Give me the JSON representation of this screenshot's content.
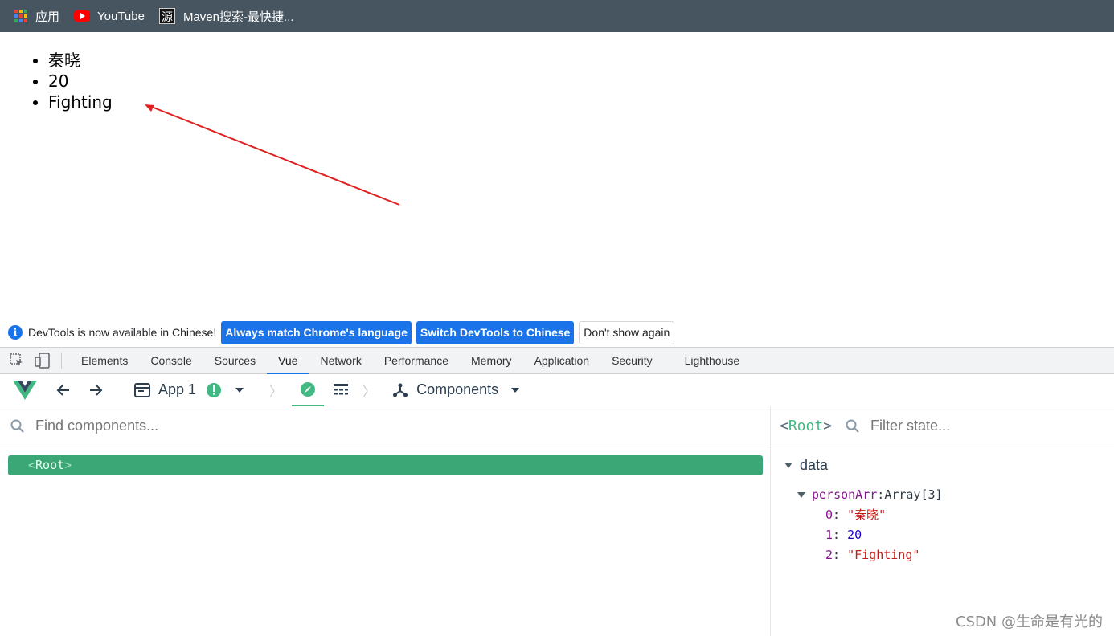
{
  "bookmarks": [
    {
      "label": "应用",
      "icon": "apps-grid-icon"
    },
    {
      "label": "YouTube",
      "icon": "youtube-icon"
    },
    {
      "label": "Maven搜索-最快捷...",
      "icon": "source-icon",
      "icon_text": "源"
    }
  ],
  "page": {
    "list": [
      "秦晓",
      "20",
      "Fighting"
    ]
  },
  "infobar": {
    "message": "DevTools is now available in Chinese!",
    "btn_match": "Always match Chrome's language",
    "btn_switch": "Switch DevTools to Chinese",
    "btn_dismiss": "Don't show again"
  },
  "devtools_tabs": [
    "Elements",
    "Console",
    "Sources",
    "Vue",
    "Network",
    "Performance",
    "Memory",
    "Application",
    "Security",
    "Lighthouse"
  ],
  "active_tab": "Vue",
  "vue_toolbar": {
    "app_label": "App 1",
    "view_label": "Components"
  },
  "components": {
    "search_placeholder": "Find components...",
    "root_name": "Root"
  },
  "inspector": {
    "selected": "Root",
    "filter_placeholder": "Filter state...",
    "section": "data",
    "prop_name": "personArr",
    "prop_type": "Array[3]",
    "items": [
      {
        "index": "0",
        "value": "\"秦晓\"",
        "kind": "string"
      },
      {
        "index": "1",
        "value": "20",
        "kind": "number"
      },
      {
        "index": "2",
        "value": "\"Fighting\"",
        "kind": "string"
      }
    ]
  },
  "watermark": "CSDN @生命是有光的",
  "colors": {
    "bookmark_bar": "#46555f",
    "vue_green": "#42b983",
    "root_row": "#3ba776",
    "chrome_blue": "#1a73e8",
    "annotation_arrow": "#e02020"
  }
}
